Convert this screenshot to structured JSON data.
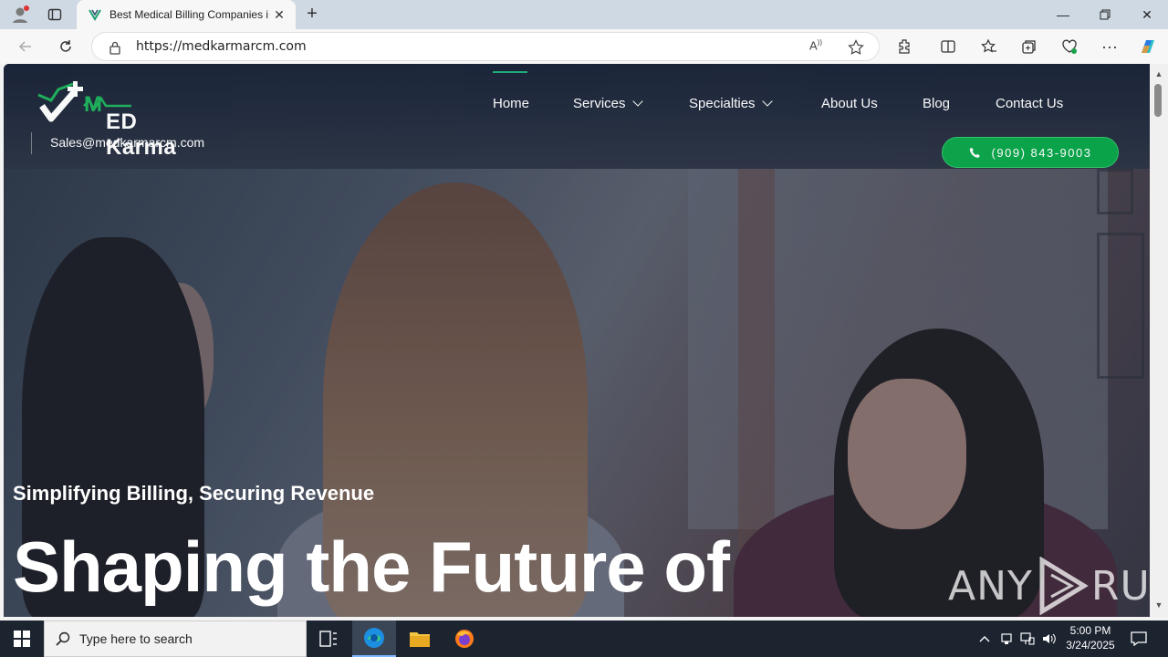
{
  "browser": {
    "tab_title": "Best Medical Billing Companies i",
    "url": "https://medkarmarcm.com"
  },
  "site": {
    "logo_text": "ED Karma",
    "email": "Sales@medkarmarcm.com",
    "nav": [
      {
        "label": "Home",
        "active": true
      },
      {
        "label": "Services",
        "dropdown": true
      },
      {
        "label": "Specialties",
        "dropdown": true
      },
      {
        "label": "About Us"
      },
      {
        "label": "Blog"
      },
      {
        "label": "Contact Us"
      }
    ],
    "phone": "(909) 843-9003",
    "accent_color": "#0aa74a"
  },
  "hero": {
    "subtitle": "Simplifying Billing, Securing Revenue",
    "title": "Shaping the Future of"
  },
  "watermark": {
    "left": "ANY",
    "right": "RUN"
  },
  "taskbar": {
    "search_placeholder": "Type here to search",
    "time": "5:00 PM",
    "date": "3/24/2025"
  }
}
